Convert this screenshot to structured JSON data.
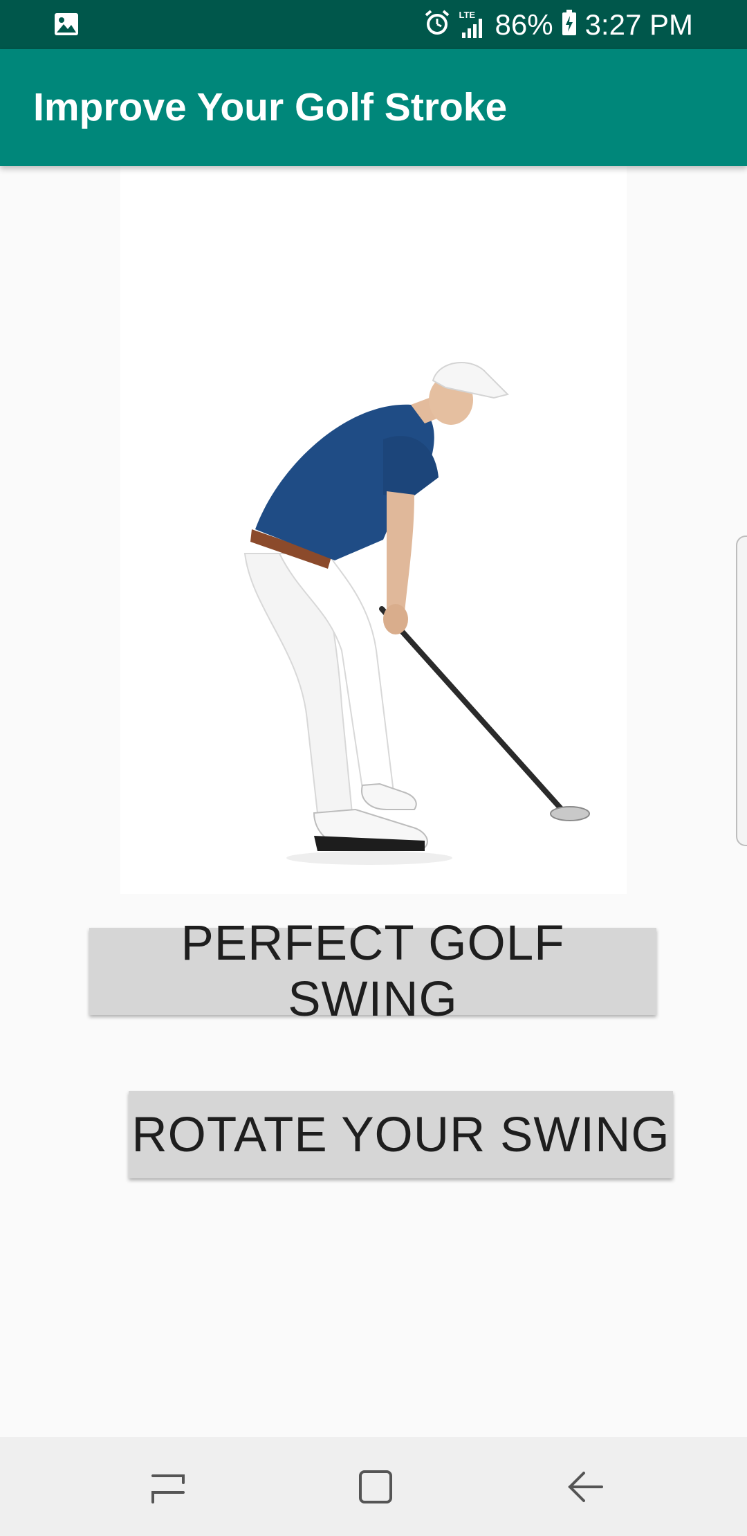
{
  "status_bar": {
    "battery": "86%",
    "time": "3:27 PM",
    "network": "LTE",
    "icons": [
      "gallery-icon",
      "alarm-icon",
      "signal-icon",
      "battery-icon"
    ]
  },
  "app_bar": {
    "title": "Improve Your Golf Stroke",
    "color": "#00877a"
  },
  "main": {
    "buttons": [
      {
        "label": "PERFECT GOLF SWING"
      },
      {
        "label": "ROTATE YOUR SWING"
      }
    ]
  },
  "nav_bar": {
    "items": [
      "recents-icon",
      "home-icon",
      "back-icon"
    ]
  },
  "colors": {
    "status_bar": "#00574b",
    "app_bar": "#00877a",
    "button": "#d6d6d6",
    "background": "#fafafa"
  }
}
